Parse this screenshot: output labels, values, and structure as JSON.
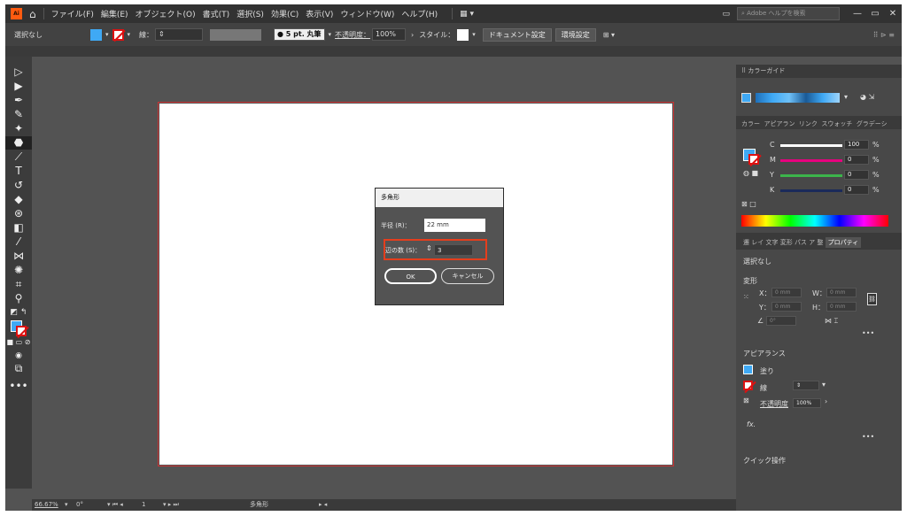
{
  "menubar": {
    "logo": "Ai",
    "items": [
      "ファイル(F)",
      "編集(E)",
      "オブジェクト(O)",
      "書式(T)",
      "選択(S)",
      "効果(C)",
      "表示(V)",
      "ウィンドウ(W)",
      "ヘルプ(H)"
    ],
    "search_placeholder": "Adobe ヘルプを検索"
  },
  "controlbar": {
    "selection": "選択なし",
    "stroke_label": "線：",
    "brush": "5 pt. 丸筆",
    "opacity_label": "不透明度：",
    "opacity_value": "100%",
    "style_label": "スタイル：",
    "doc_settings": "ドキュメント設定",
    "preferences": "環境設定"
  },
  "dialog": {
    "title": "多角形",
    "radius_label": "半径 (R)：",
    "radius_value": "22 mm",
    "sides_label": "辺の数 (S)：",
    "sides_value": "3",
    "ok": "OK",
    "cancel": "キャンセル"
  },
  "color_guide": {
    "title": "カラーガイド"
  },
  "color_panel": {
    "tabs": [
      "カラー",
      "アピアラン",
      "リンク",
      "スウォッチ",
      "グラデーシ"
    ],
    "channels": [
      {
        "name": "C",
        "value": "100",
        "unit": "%"
      },
      {
        "name": "M",
        "value": "0",
        "unit": "%"
      },
      {
        "name": "Y",
        "value": "0",
        "unit": "%"
      },
      {
        "name": "K",
        "value": "0",
        "unit": "%"
      }
    ]
  },
  "properties": {
    "tabs": [
      "遷",
      "レイ",
      "文字",
      "変形",
      "パス",
      "ア",
      "整",
      "プロパティ"
    ],
    "selection": "選択なし",
    "transform_title": "変形",
    "x_label": "X：",
    "x_value": "0 mm",
    "y_label": "Y：",
    "y_value": "0 mm",
    "w_label": "W：",
    "w_value": "0 mm",
    "h_label": "H：",
    "h_value": "0 mm",
    "angle_value": "0°",
    "appearance_title": "アピアランス",
    "fill_label": "塗り",
    "stroke_label": "線",
    "opacity_label": "不透明度",
    "opacity_value": "100%",
    "fx": "fx.",
    "quick_actions": "クイック操作"
  },
  "statusbar": {
    "zoom": "66.67%",
    "angle": "0°",
    "artboard": "1",
    "tool_name": "多角形"
  },
  "colors": {
    "fill": "#3fa9f5",
    "accent": "#e53e1d",
    "app_bg": "#535353"
  }
}
